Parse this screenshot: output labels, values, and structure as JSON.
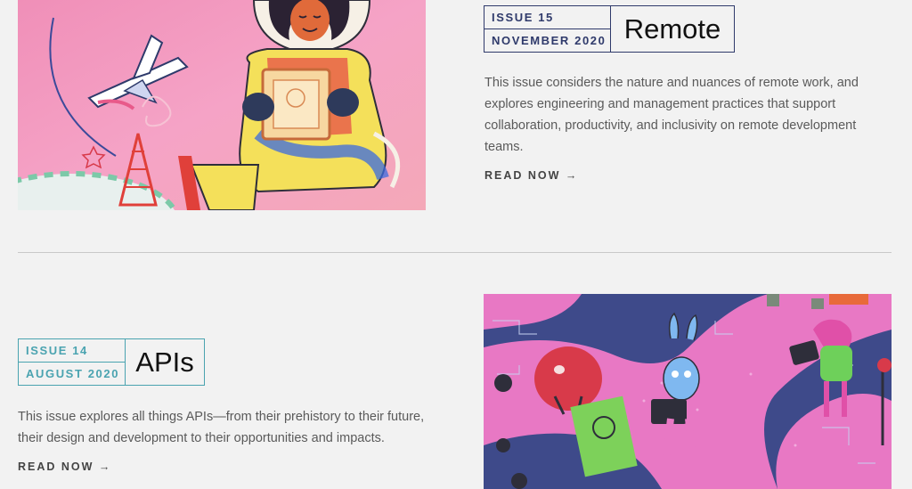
{
  "issues": [
    {
      "issue_label": "ISSUE 15",
      "date": "NOVEMBER 2020",
      "title": "Remote",
      "description": "This issue considers the nature and nuances of remote work, and explores engineering and management practices that support collaboration, productivity, and inclusivity on remote development teams.",
      "read_label": "READ NOW →",
      "accent_color": "#2f3a6b",
      "illustration": "astronaut-illustration"
    },
    {
      "issue_label": "ISSUE 14",
      "date": "AUGUST 2020",
      "title": "APIs",
      "description": "This issue explores all things APIs—from their prehistory to their future, their design and development to their opportunities and impacts.",
      "read_label": "READ NOW →",
      "accent_color": "#4aa3b0",
      "illustration": "robots-circuit-illustration"
    }
  ]
}
